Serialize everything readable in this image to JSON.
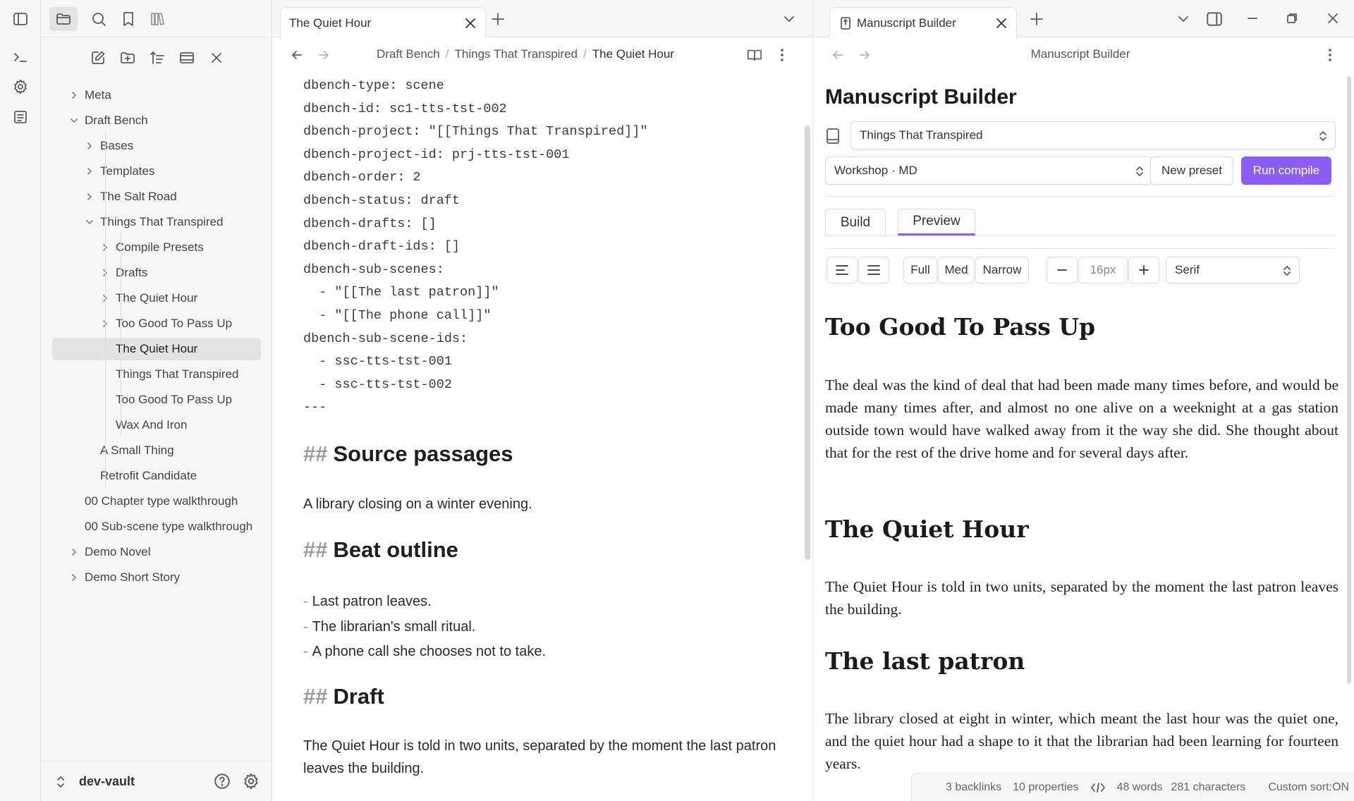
{
  "sidebar_tree": [
    {
      "label": "Meta",
      "expanded": false
    },
    {
      "label": "Draft Bench",
      "expanded": true
    },
    {
      "label": "Bases",
      "expanded": false
    },
    {
      "label": "Templates",
      "expanded": false
    },
    {
      "label": "The Salt Road",
      "expanded": false
    },
    {
      "label": "Things That Transpired",
      "expanded": true
    },
    {
      "label": "Compile Presets",
      "expanded": false
    },
    {
      "label": "Drafts",
      "expanded": false
    },
    {
      "label": "The Quiet Hour",
      "expanded": false
    },
    {
      "label": "Too Good To Pass Up",
      "expanded": false
    },
    {
      "label": "The Quiet Hour",
      "selected": true
    },
    {
      "label": "Things That Transpired"
    },
    {
      "label": "Too Good To Pass Up"
    },
    {
      "label": "Wax And Iron"
    },
    {
      "label": "A Small Thing"
    },
    {
      "label": "Retrofit Candidate"
    },
    {
      "label": "00 Chapter type walkthrough"
    },
    {
      "label": "00 Sub-scene type walkthrough"
    },
    {
      "label": "Demo Novel",
      "expanded": false
    },
    {
      "label": "Demo Short Story",
      "expanded": false
    }
  ],
  "vault": {
    "name": "dev-vault"
  },
  "editor": {
    "tab_title": "The Quiet Hour",
    "breadcrumb": [
      "Draft Bench",
      "Things That Transpired",
      "The Quiet Hour"
    ],
    "frontmatter": [
      "dbench-type: scene",
      "dbench-id: sc1-tts-tst-002",
      "dbench-project: \"[[Things That Transpired]]\"",
      "dbench-project-id: prj-tts-tst-001",
      "dbench-order: 2",
      "dbench-status: draft",
      "dbench-drafts: []",
      "dbench-draft-ids: []",
      "dbench-sub-scenes:",
      "  - \"[[The last patron]]\"",
      "  - \"[[The phone call]]\"",
      "dbench-sub-scene-ids:",
      "  - ssc-tts-tst-001",
      "  - ssc-tts-tst-002",
      "---"
    ],
    "hash": "##",
    "h_source": "Source passages",
    "source_text": "A library closing on a winter evening.",
    "h_beat": "Beat outline",
    "beats": [
      "Last patron leaves.",
      "The librarian's small ritual.",
      "A phone call she chooses not to take."
    ],
    "h_draft": "Draft",
    "draft_text": "The Quiet Hour is told in two units, separated by the moment the last patron leaves the building."
  },
  "builder": {
    "tab_title": "Manuscript Builder",
    "header_title": "Manuscript Builder",
    "title": "Manuscript Builder",
    "project": "Things That Transpired",
    "preset": "Workshop · MD",
    "new_preset": "New preset",
    "run_compile": "Run compile",
    "tabs": [
      "Build",
      "Preview"
    ],
    "active_tab": "Preview",
    "widths": [
      "Full",
      "Med",
      "Narrow"
    ],
    "font_size": "16px",
    "font_family": "Serif",
    "preview": {
      "h1": "Too Good To Pass Up",
      "p1": "The deal was the kind of deal that had been made many times before, and would be made many times after, and almost no one alive on a weeknight at a gas station outside town would have walked away from it the way she did. She thought about that for the rest of the drive home and for several days after.",
      "h2": "The Quiet Hour",
      "p2": "The Quiet Hour is told in two units, separated by the moment the last patron leaves the building.",
      "h3": "The last patron",
      "p3": "The library closed at eight in winter, which meant the last hour was the quiet one, and the quiet hour had a shape to it that the librarian had been learning for fourteen years."
    }
  },
  "status": {
    "backlinks": "3 backlinks",
    "properties": "10 properties",
    "words": "48 words",
    "characters": "281 characters",
    "sort": "Custom sort:ON"
  },
  "colors": {
    "accent": "#8b5cf6",
    "chrome": "#f6f6f6",
    "selected": "#e3e3e3"
  }
}
